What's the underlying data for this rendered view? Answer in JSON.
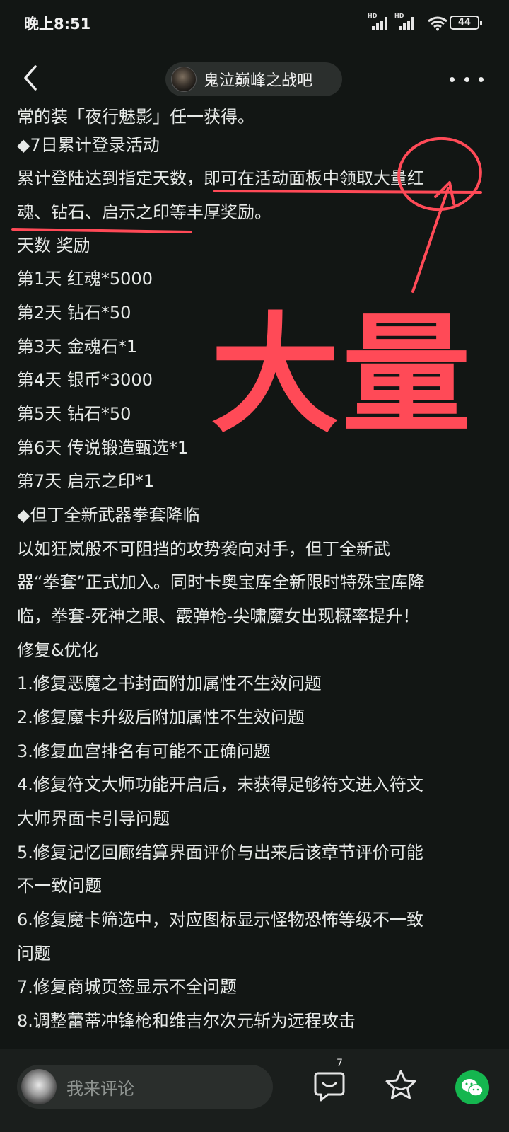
{
  "status_bar": {
    "time": "晚上8:51",
    "signal1_label": "HD",
    "signal2_label": "HD",
    "battery": "44"
  },
  "nav": {
    "forum_title": "鬼泣巅峰之战吧",
    "icons": [
      "back-arrow-icon",
      "forum-avatar",
      "more-dots-icon"
    ]
  },
  "post": {
    "cut_line": "常的装「夜行魅影」任一获得。",
    "lines": [
      "◆7日累计登录活动",
      "累计登陆达到指定天数，即可在活动面板中领取大量红",
      "魂、钻石、启示之印等丰厚奖励。",
      "天数 奖励",
      "第1天 红魂*5000",
      "第2天 钻石*50",
      "第3天 金魂石*1",
      "第4天 银币*3000",
      "第5天 钻石*50",
      "第6天 传说锻造甄选*1",
      "第7天 启示之印*1",
      "◆但丁全新武器拳套降临",
      "以如狂岚般不可阻挡的攻势袭向对手，但丁全新武",
      "器“拳套”正式加入。同时卡奥宝库全新限时特殊宝库降",
      "临，拳套-死神之眼、霰弹枪-尖啸魔女出现概率提升！",
      "修复&优化",
      "1.修复恶魔之书封面附加属性不生效问题",
      "2.修复魔卡升级后附加属性不生效问题",
      "3.修复血宫排名有可能不正确问题",
      "4.修复符文大师功能开启后，未获得足够符文进入符文",
      "大师界面卡引导问题",
      "5.修复记忆回廊结算界面评价与出来后该章节评价可能",
      "不一致问题",
      "6.修复魔卡筛选中，对应图标显示怪物恐怖等级不一致",
      "问题",
      "7.修复商城页签显示不全问题",
      "8.调整蕾蒂冲锋枪和维吉尔次元斩为远程攻击"
    ]
  },
  "annotation": {
    "big_text": "大量",
    "color": "#ff4a57"
  },
  "bottom_bar": {
    "comment_placeholder": "我来评论",
    "reply_count": "7",
    "icons": [
      "user-avatar",
      "reply-bubble-icon",
      "star-icon",
      "wechat-icon"
    ],
    "wechat_color": "#15b64f"
  }
}
